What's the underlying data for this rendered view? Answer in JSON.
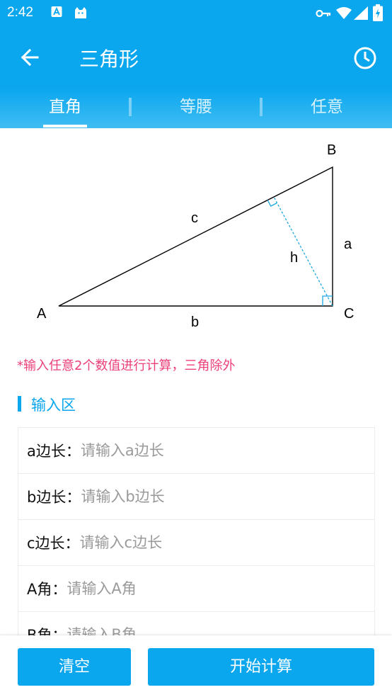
{
  "status_bar": {
    "time": "2:42",
    "icons": [
      "notification-a-icon",
      "cat-app-icon",
      "vpn-key-icon",
      "wifi-icon",
      "signal-icon",
      "battery-icon"
    ]
  },
  "toolbar": {
    "title": "三角形",
    "back_icon": "arrow-left-icon",
    "history_icon": "history-clock-icon"
  },
  "tabs": [
    {
      "label": "直角",
      "active": true
    },
    {
      "label": "等腰",
      "active": false
    },
    {
      "label": "任意",
      "active": false
    }
  ],
  "diagram": {
    "vertex_labels": {
      "A": "A",
      "B": "B",
      "C": "C"
    },
    "side_labels": {
      "a": "a",
      "b": "b",
      "c": "c",
      "h": "h"
    }
  },
  "hint": "*输入任意2个数值进行计算，三角除外",
  "input_section": {
    "title": "输入区",
    "fields": [
      {
        "label": "a边长：",
        "placeholder": "请输入a边长",
        "value": ""
      },
      {
        "label": "b边长：",
        "placeholder": "请输入b边长",
        "value": ""
      },
      {
        "label": "c边长：",
        "placeholder": "请输入c边长",
        "value": ""
      },
      {
        "label": "A角：",
        "placeholder": "请输入A角",
        "value": ""
      },
      {
        "label": "B角：",
        "placeholder": "请输入B角",
        "value": ""
      }
    ]
  },
  "buttons": {
    "clear": "清空",
    "calculate": "开始计算"
  },
  "colors": {
    "primary": "#0aa6ee",
    "hint": "#ec407a",
    "altitude_line": "#1ba8e0"
  }
}
